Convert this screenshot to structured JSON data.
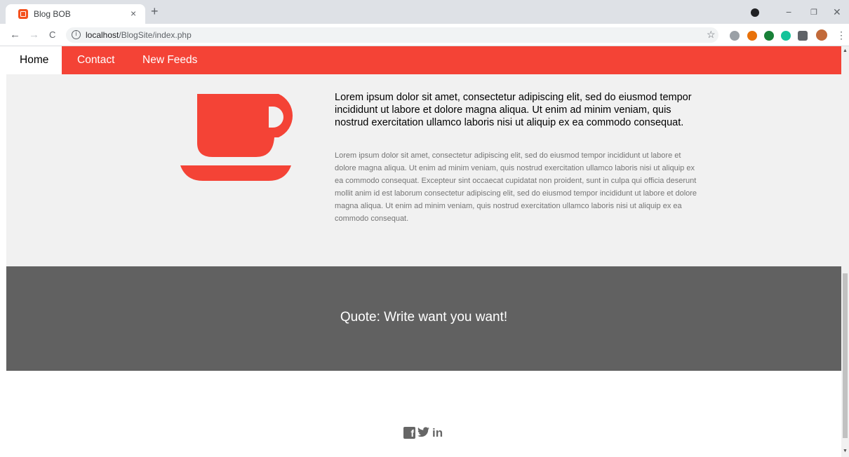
{
  "browser": {
    "tab_title": "Blog BOB",
    "tab_close": "×",
    "new_tab": "+",
    "url_host": "localhost",
    "url_path": "/BlogSite/index.php",
    "back": "←",
    "forward": "→",
    "reload": "C",
    "info": "i",
    "star": "☆",
    "minimize": "−",
    "restore": "❐",
    "close": "✕",
    "menu": "⋮",
    "extensions": [
      {
        "name": "bug-extension-icon",
        "color": "#5f6368"
      },
      {
        "name": "rupee-extension-icon",
        "color": "#e8710a"
      },
      {
        "name": "tree-extension-icon",
        "color": "#188038"
      },
      {
        "name": "grammarly-extension-icon",
        "color": "#15c39a"
      },
      {
        "name": "puzzle-extension-icon",
        "color": "#5f6368"
      },
      {
        "name": "avatar-icon",
        "color": "#c26a3a"
      }
    ]
  },
  "nav": {
    "home": "Home",
    "contact": "Contact",
    "feeds": "New Feeds"
  },
  "content": {
    "lead": "Lorem ipsum dolor sit amet, consectetur adipiscing elit, sed do eiusmod tempor incididunt ut labore et dolore magna aliqua. Ut enim ad minim veniam, quis nostrud exercitation ullamco laboris nisi ut aliquip ex ea commodo consequat.",
    "body": "Lorem ipsum dolor sit amet, consectetur adipiscing elit, sed do eiusmod tempor incididunt ut labore et dolore magna aliqua. Ut enim ad minim veniam, quis nostrud exercitation ullamco laboris nisi ut aliquip ex ea commodo consequat. Excepteur sint occaecat cupidatat non proident, sunt in culpa qui officia deserunt mollit anim id est laborum consectetur adipiscing elit, sed do eiusmod tempor incididunt ut labore et dolore magna aliqua. Ut enim ad minim veniam, quis nostrud exercitation ullamco laboris nisi ut aliquip ex ea commodo consequat."
  },
  "quote": "Quote: Write want you want!",
  "footer": {
    "facebook": "f",
    "twitter": "🐦",
    "linkedin": "in"
  },
  "colors": {
    "accent": "#f44336",
    "quote_band": "#616161",
    "content_bg": "#f1f1f1"
  }
}
